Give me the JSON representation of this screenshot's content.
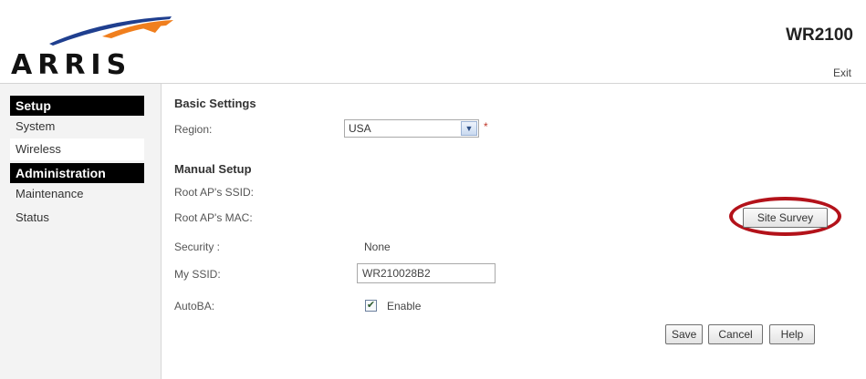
{
  "header": {
    "brand": "ARRIS",
    "model": "WR2100",
    "exit_label": "Exit"
  },
  "sidebar": {
    "sections": [
      {
        "title": "Setup",
        "items": [
          "System",
          "Wireless"
        ]
      },
      {
        "title": "Administration",
        "items": [
          "Maintenance",
          "Status"
        ]
      }
    ],
    "active_item": "Wireless"
  },
  "main": {
    "basic_settings_title": "Basic Settings",
    "region_label": "Region:",
    "region_value": "USA",
    "required_mark": "*",
    "manual_setup_title": "Manual Setup",
    "root_ssid_label": "Root AP's SSID:",
    "root_mac_label": "Root AP's MAC:",
    "site_survey_label": "Site Survey",
    "security_label": "Security :",
    "security_value": "None",
    "my_ssid_label": "My SSID:",
    "my_ssid_value": "WR210028B2",
    "autoba_label": "AutoBA:",
    "autoba_checked": true,
    "autoba_option": "Enable",
    "save_label": "Save",
    "cancel_label": "Cancel",
    "help_label": "Help"
  },
  "colors": {
    "highlight_ring": "#b3121a",
    "logo_arc_blue": "#1f3f8f",
    "logo_arc_orange": "#f07f1e"
  },
  "icons": {
    "logo": "arris-logo-icon",
    "dropdown": "chevron-down-icon",
    "checkbox": "checkmark-icon"
  }
}
